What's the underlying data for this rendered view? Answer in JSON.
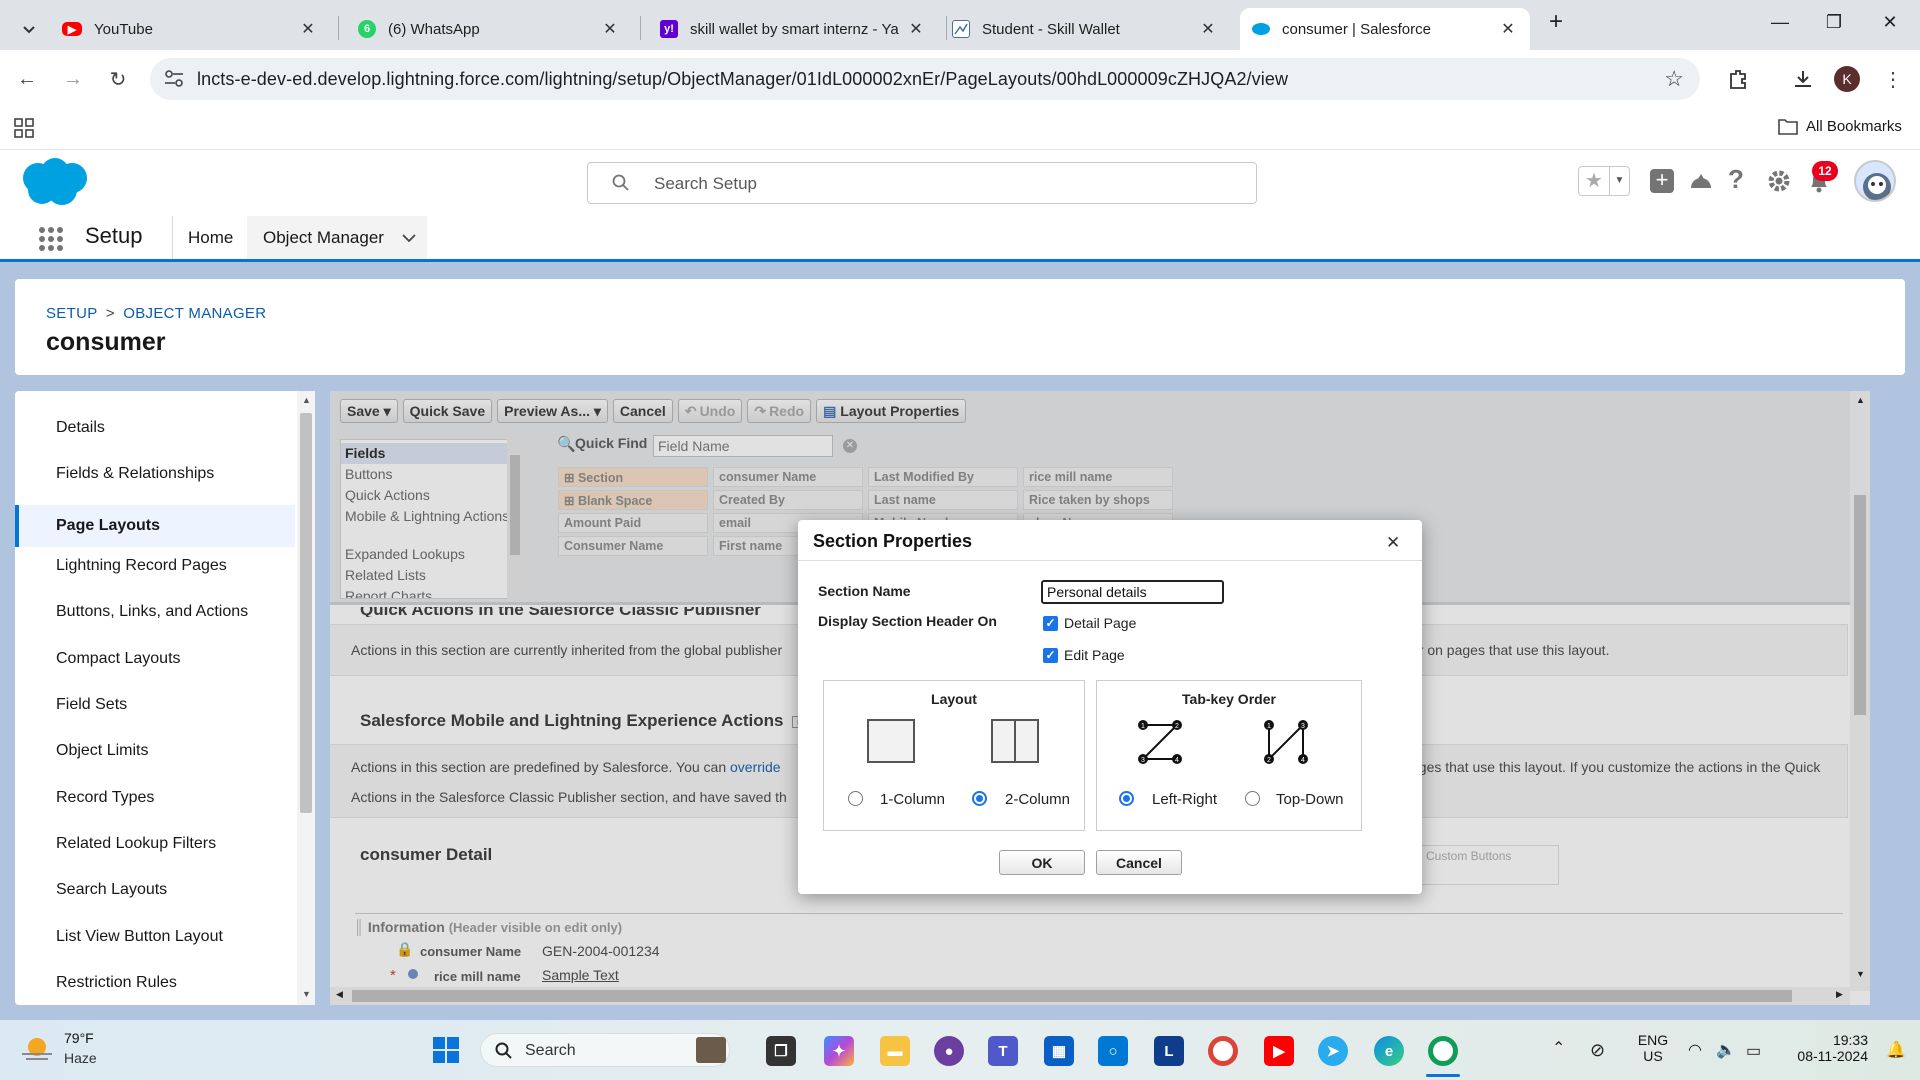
{
  "browser": {
    "tabs": [
      {
        "title": "YouTube",
        "icon": "youtube-icon",
        "color": "#ff0000"
      },
      {
        "title": "(6) WhatsApp",
        "icon": "whatsapp-icon",
        "color": "#25d366",
        "badge": "6"
      },
      {
        "title": "skill wallet by smart internz - Ya",
        "icon": "yahoo-icon",
        "color": "#6001d2"
      },
      {
        "title": "Student - Skill Wallet",
        "icon": "skillwallet-icon",
        "color": "#4a6fa5"
      },
      {
        "title": "consumer | Salesforce",
        "icon": "salesforce-icon",
        "color": "#00a1e0"
      }
    ],
    "url": "lncts-e-dev-ed.develop.lightning.force.com/lightning/setup/ObjectManager/01IdL000002xnEr/PageLayouts/00hdL000009cZHJQA2/view",
    "bookmarks_label": "All Bookmarks",
    "profile_initial": "K"
  },
  "salesforce": {
    "search_placeholder": "Search Setup",
    "notification_count": "12",
    "app_name": "Setup",
    "nav_tabs": [
      "Home",
      "Object Manager"
    ],
    "breadcrumb": [
      "SETUP",
      ">",
      "OBJECT MANAGER"
    ],
    "object_title": "consumer",
    "brand_color": "#0176d3"
  },
  "sidebar": {
    "items": [
      "Details",
      "Fields & Relationships",
      "Page Layouts",
      "Lightning Record Pages",
      "Buttons, Links, and Actions",
      "Compact Layouts",
      "Field Sets",
      "Object Limits",
      "Record Types",
      "Related Lookup Filters",
      "Search Layouts",
      "List View Button Layout",
      "Restriction Rules"
    ],
    "selected": "Page Layouts"
  },
  "editor": {
    "toolbar": [
      "Save ▾",
      "Quick Save",
      "Preview As... ▾",
      "Cancel",
      "Undo",
      "Redo",
      "Layout Properties"
    ],
    "categories": [
      "Fields",
      "Buttons",
      "Quick Actions",
      "Mobile & Lightning Actions",
      "Expanded Lookups",
      "Related Lists",
      "Report Charts"
    ],
    "quick_find_label": "Quick Find",
    "quick_find_placeholder": "Field Name",
    "fields": [
      [
        "Section",
        "consumer Name",
        "Last Modified By",
        "rice mill name"
      ],
      [
        "Blank Space",
        "Created By",
        "Last name",
        "Rice taken by shops"
      ],
      [
        "Amount Paid",
        "email",
        "Mobile Number",
        "shop Name"
      ],
      [
        "Consumer Name",
        "First name",
        "",
        ""
      ]
    ],
    "sections": {
      "quick_actions_title": "Quick Actions in the Salesforce Classic Publisher",
      "quick_actions_text": "Actions in this section are currently inherited from the global publisher",
      "quick_actions_text_tail": "er on pages that use this layout.",
      "mobile_title": "Salesforce Mobile and Lightning Experience Actions",
      "mobile_text_1a": "Actions in this section are predefined by Salesforce. You can",
      "mobile_link": "override",
      "mobile_text_1b": "ages that use this layout. If you customize the actions in the Quick",
      "mobile_text_2": "Actions in the Salesforce Classic Publisher section, and have saved th",
      "detail_title": "consumer Detail",
      "custom_buttons": "Custom Buttons",
      "info_title": "Information",
      "info_note": "(Header visible on edit only)",
      "row1_label": "consumer Name",
      "row1_value": "GEN-2004-001234",
      "row2_label": "rice mill name",
      "row2_value": "Sample Text"
    }
  },
  "modal": {
    "title": "Section Properties",
    "section_name_label": "Section Name",
    "section_name_value": "Personal details",
    "display_label": "Display Section Header On",
    "detail_page": "Detail Page",
    "detail_page_checked": true,
    "edit_page": "Edit Page",
    "edit_page_checked": true,
    "layout_title": "Layout",
    "layout_options": [
      "1-Column",
      "2-Column"
    ],
    "layout_selected": "2-Column",
    "tab_title": "Tab-key Order",
    "tab_options": [
      "Left-Right",
      "Top-Down"
    ],
    "tab_selected": "Left-Right",
    "ok": "OK",
    "cancel": "Cancel"
  },
  "taskbar": {
    "weather_temp": "79°F",
    "weather_desc": "Haze",
    "search_label": "Search",
    "language": "ENG",
    "region": "US",
    "time": "19:33",
    "date": "08-11-2024"
  }
}
